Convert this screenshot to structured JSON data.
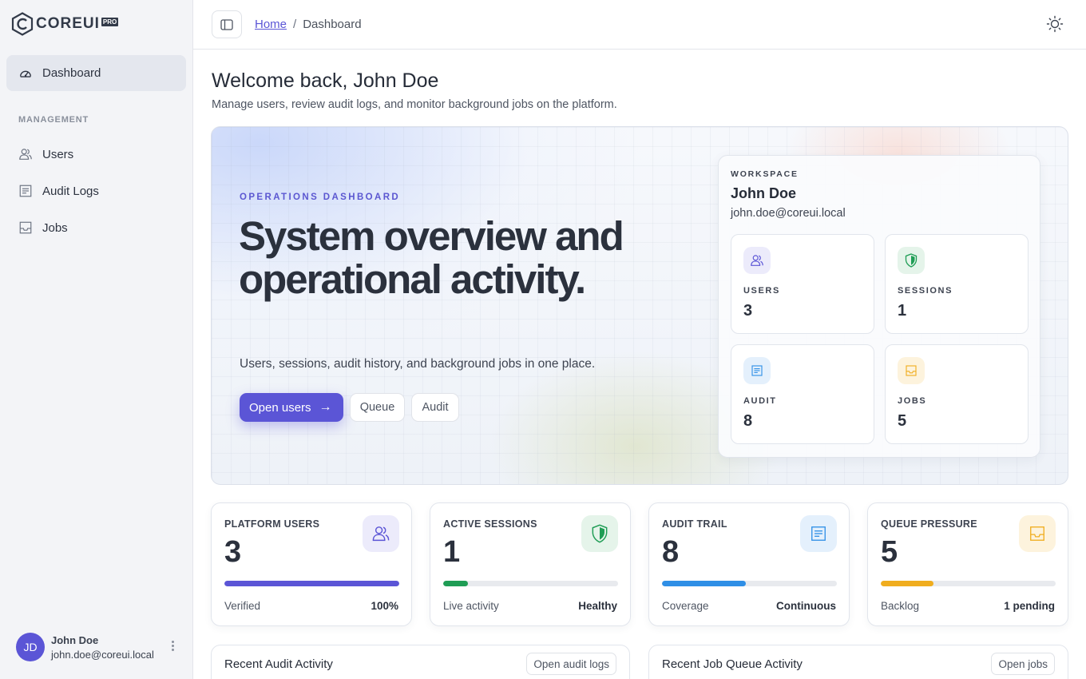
{
  "brand": {
    "name": "COREUI",
    "badge": "PRO"
  },
  "sidebar": {
    "active_item": "Dashboard",
    "section": "MANAGEMENT",
    "items": [
      {
        "label": "Users",
        "icon": "users-icon"
      },
      {
        "label": "Audit Logs",
        "icon": "list-icon"
      },
      {
        "label": "Jobs",
        "icon": "inbox-icon"
      }
    ],
    "user": {
      "initials": "JD",
      "name": "John Doe",
      "email": "john.doe@coreui.local"
    }
  },
  "header": {
    "breadcrumb": {
      "home": "Home",
      "separator": "/",
      "current": "Dashboard"
    },
    "theme_icon": "sun-icon"
  },
  "welcome": {
    "title": "Welcome back, John Doe",
    "subtitle": "Manage users, review audit logs, and monitor background jobs on the platform."
  },
  "hero": {
    "eyebrow": "OPERATIONS DASHBOARD",
    "title": "System overview and operational activity.",
    "subtitle": "Users, sessions, audit history, and background jobs in one place.",
    "primary_button": "Open users",
    "buttons": [
      "Queue",
      "Audit"
    ],
    "workspace": {
      "eyebrow": "WORKSPACE",
      "name": "John Doe",
      "email": "john.doe@coreui.local",
      "tiles": [
        {
          "label": "USERS",
          "value": "3",
          "icon": "users-icon",
          "color": "#5b55d6"
        },
        {
          "label": "SESSIONS",
          "value": "1",
          "icon": "shield-icon",
          "color": "#1f9d55"
        },
        {
          "label": "AUDIT",
          "value": "8",
          "icon": "list-icon",
          "color": "#2f8fe6"
        },
        {
          "label": "JOBS",
          "value": "5",
          "icon": "inbox-icon",
          "color": "#f0ad1e"
        }
      ]
    }
  },
  "stats": [
    {
      "label": "PLATFORM USERS",
      "value": "3",
      "icon": "users-icon",
      "color": "#5b55d6",
      "progress": 1.0,
      "foot_label": "Verified",
      "foot_value": "100%"
    },
    {
      "label": "ACTIVE SESSIONS",
      "value": "1",
      "icon": "shield-icon",
      "color": "#1f9d55",
      "progress": 0.14,
      "foot_label": "Live activity",
      "foot_value": "Healthy"
    },
    {
      "label": "AUDIT TRAIL",
      "value": "8",
      "icon": "list-icon",
      "color": "#2f8fe6",
      "progress": 0.48,
      "foot_label": "Coverage",
      "foot_value": "Continuous"
    },
    {
      "label": "QUEUE PRESSURE",
      "value": "5",
      "icon": "inbox-icon",
      "color": "#f0ad1e",
      "progress": 0.3,
      "foot_label": "Backlog",
      "foot_value": "1 pending"
    }
  ],
  "panels": [
    {
      "title": "Recent Audit Activity",
      "button": "Open audit logs"
    },
    {
      "title": "Recent Job Queue Activity",
      "button": "Open jobs"
    }
  ]
}
